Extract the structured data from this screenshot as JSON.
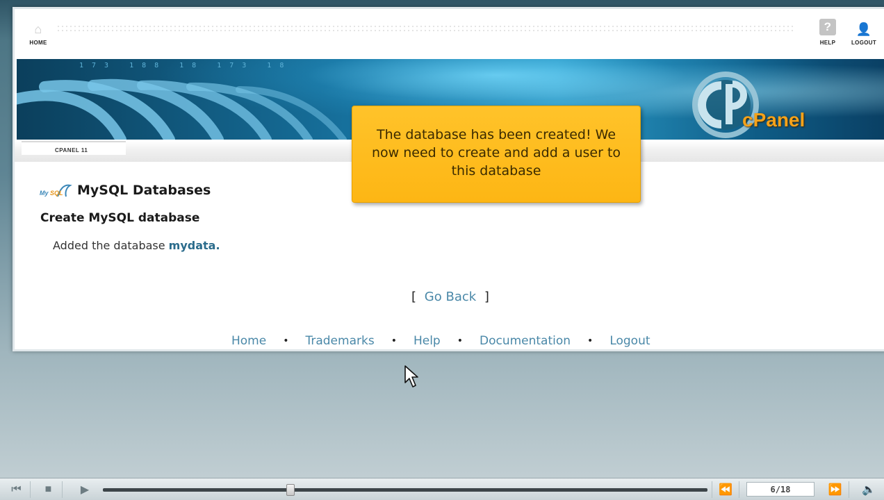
{
  "topbar": {
    "home_label": "HOME",
    "help_label": "HELP",
    "logout_label": "LOGOUT",
    "help_glyph": "?"
  },
  "banner": {
    "brand": "cPanel",
    "numbers": "173 188 18 173 18"
  },
  "subbar": {
    "label": "CPANEL 11"
  },
  "page": {
    "title": "MySQL Databases",
    "logo_text_my": "My",
    "logo_text_sql": "SQL",
    "section_title": "Create MySQL database",
    "added_prefix": "Added the database ",
    "db_name": "mydata",
    "added_suffix": ".",
    "goback_open": "[",
    "goback_label": "Go Back",
    "goback_close": "]"
  },
  "footer": {
    "links": [
      "Home",
      "Trademarks",
      "Help",
      "Documentation",
      "Logout"
    ],
    "separator": "•"
  },
  "callout": {
    "text": "The database has been created! We now need to create and add a user to this database"
  },
  "player": {
    "counter": "6/18",
    "progress": 0.31
  },
  "icons": {
    "home": "home-icon",
    "help": "help-icon",
    "logout": "user-icon",
    "cursor": "mouse-pointer-icon"
  },
  "colors": {
    "link": "#4a88a8",
    "callout_bg": "#fdb614",
    "brand_orange": "#f4a21a"
  }
}
